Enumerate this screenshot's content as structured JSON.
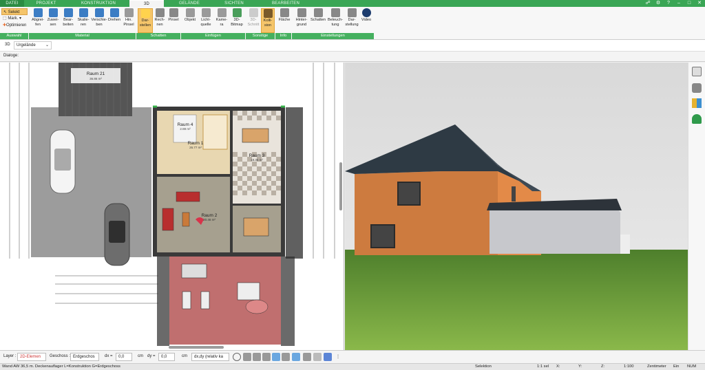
{
  "tabs": {
    "file": "DATEI",
    "projekt": "PROJEKT",
    "konstruktion": "KONSTRUKTION",
    "d3": "3D",
    "gelaende": "GELÄNDE",
    "sichten": "SICHTEN",
    "bearbeiten": "BEARBEITEN"
  },
  "ribbon": {
    "selekt": "Selekt",
    "mark": "Mark.",
    "optimieren": "Optimieren",
    "items": {
      "abgreifen": "Abgrei-\nfen",
      "zuweisen": "Zuwei-\nsen",
      "bearbeiten": "Bear-\nbeiten",
      "skalieren": "Skalie-\nren",
      "verschieben": "Verschie-\nben",
      "drehen": "Drehen",
      "hinpinsel": "Hin.\nPinsel",
      "darstellen": "Dar-\nstellen",
      "rechnen": "Rech-\nnen",
      "pinsel": "Pinsel",
      "objekt": "Objekt",
      "lichtquelle": "Licht-\nquelle",
      "kamera": "Kame-\nra",
      "bitmap": "3D-\nBitmap",
      "schnitt": "3D-\nSchnitt",
      "kollision": "Kolli-\nsion",
      "flaeche": "Fläche",
      "hintergrund": "Hinter-\ngrund",
      "schatten": "Schatten",
      "beleuchtung": "Beleuch-\ntung",
      "darstellung": "Dar-\nstellung",
      "video": "Video"
    },
    "groups": {
      "auswahl": "Auswahl",
      "material": "Material",
      "schatten": "Schatten",
      "einfuegen": "Einfügen",
      "sonstige": "Sonstige",
      "info": "Info",
      "einstellungen": "Einstellungen"
    }
  },
  "subbar": {
    "mode": "3D",
    "terrain": "Urgelände"
  },
  "dialog_label": "Dialoge:",
  "plan": {
    "room21": {
      "name": "Raum 21",
      "area": "36.86 m²"
    },
    "room4": {
      "name": "Raum 4",
      "area": "2.88 m²"
    },
    "room1": {
      "name": "Raum 1",
      "area": "26.77 m²"
    },
    "room3": {
      "name": "Raum 3",
      "area": "18.35 m²"
    },
    "room2": {
      "name": "Raum 2",
      "area": "20.46 m²"
    }
  },
  "bottombar": {
    "layer_label": "Layer :",
    "layer_value": "2D-Elemen",
    "geschoss_label": "Geschoss :",
    "geschoss_value": "Erdgeschos",
    "dx_label": "dx =",
    "dx_value": "0,0",
    "dx_unit": "cm",
    "dy_label": "dy =",
    "dy_value": "0,0",
    "dy_unit": "cm",
    "mode_value": "dx,dy (relativ ka"
  },
  "status": {
    "info": "Wand AW 36,5 m. Deckenauflager L=Konstruktion G=Erdgeschoss",
    "selection": "Selektion",
    "sel_count": "1:1 sel",
    "x": "X:",
    "y": "Y:",
    "z": "Z:",
    "scale": "1:100",
    "unit": "Zentimeter",
    "ein": "Ein",
    "num": "NUM"
  }
}
